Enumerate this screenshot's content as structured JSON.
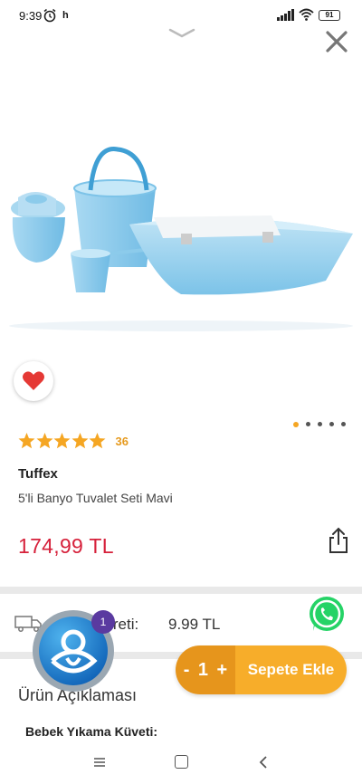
{
  "status_bar": {
    "time": "9:39",
    "extra": "h",
    "battery": "91"
  },
  "product": {
    "rating_count": "36",
    "stars": 5,
    "brand": "Tuffex",
    "name": "5'li Banyo Tuvalet Seti Mavi",
    "price": "174,99 TL",
    "image_slides": 5,
    "active_slide": 1
  },
  "shipping": {
    "label": "Kargo Ücreti:",
    "cost": "9.99 TL"
  },
  "cart": {
    "minus": "-",
    "quantity": "1",
    "plus": "+",
    "add_label": "Sepete Ekle"
  },
  "assistant": {
    "badge": "1"
  },
  "description": {
    "title": "Ürün Açıklaması",
    "subtitle": "Bebek Yıkama Küveti:"
  },
  "colors": {
    "price": "#d6203a",
    "accent": "#f7ad2a",
    "accent_dark": "#e6951c",
    "star": "#f5a623",
    "heart": "#e53935"
  },
  "icons": {
    "close": "close-icon",
    "favorite": "heart-icon",
    "share": "share-icon",
    "whatsapp": "whatsapp-icon",
    "shipping": "truck-icon"
  }
}
